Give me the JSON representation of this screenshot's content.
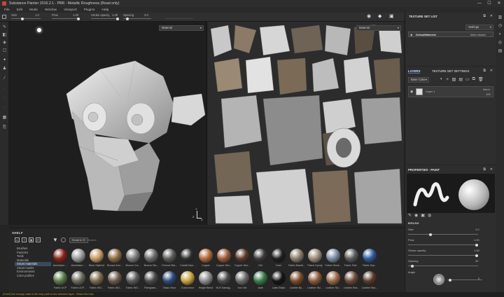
{
  "window": {
    "title": "Substance Painter 2016.2.1 - PBR - Metallic Roughness (Read only)",
    "controls": [
      "—",
      "☐",
      "✕"
    ]
  },
  "menu": [
    "File",
    "Edit",
    "Mode",
    "Window",
    "Viewport",
    "Plugins",
    "Help"
  ],
  "toolbar": {
    "size_label": "Size",
    "size_value": "1.0",
    "flow_label": "Flow",
    "flow_value": "1.00",
    "stroke_opacity_label": "Stroke opacity",
    "stroke_opacity_value": "1.00",
    "spacing_label": "Spacing",
    "spacing_value": "3.0"
  },
  "viewport3d": {
    "channel_dropdown": "Material",
    "axis_labels": {
      "x": "X",
      "y": "Y",
      "z": "Z"
    }
  },
  "viewport2d": {
    "channel_dropdown": "Material"
  },
  "shelf": {
    "title": "SHELF",
    "filter_tag": "Smart m",
    "search_placeholder": "Search...",
    "categories": [
      "Brushes",
      "Particles",
      "Tools",
      "Materials",
      "Smart materials",
      "Smart masks",
      "Environments",
      "Color profiles"
    ],
    "selected_category": "Smart materials",
    "materials_row1": [
      "Aluminium ...",
      "Aluminium ...",
      "Bone Stylized",
      "Bronze Arm...",
      "Bronze Cor...",
      "Bronze Sta...",
      "Chrome Bla...",
      "Cobalt Dam...",
      "Copper",
      "Copper Wor...",
      "Copper Wor...",
      "Dirt",
      "Dust",
      "Fabric Baseb...",
      "Fabric Sporty",
      "Fabric Stock...",
      "Fabric Soft...",
      "Fabric Sup..."
    ],
    "materials_row2": [
      "Fabric UCP",
      "Fabric UCP...",
      "Fabric WO...",
      "Fabric WO...",
      "Fabric WO...",
      "Fiberglass ...",
      "Glass Visor",
      "Gold Armor",
      "Height Blend",
      "HLR Damag...",
      "Iron Old",
      "Jade",
      "Latex Black",
      "Leather Bu...",
      "Leather Ski...",
      "Leather Ski...",
      "Leather Sea...",
      "Leather Sea..."
    ],
    "row1_colors": [
      "#8a2318",
      "#9a9a9a",
      "#c49a66",
      "#8a6a44",
      "#7a7a7a",
      "#6a6a6a",
      "#5a5a5a",
      "#2e2e2e",
      "#b06a3a",
      "#9a5a3a",
      "#5a3a2a",
      "#3a3a3a",
      "#1e1e1e",
      "#8a7a6a",
      "#9a8a7a",
      "#7a8aa0",
      "#5a5a5a",
      "#2e5a9a"
    ],
    "row2_colors": [
      "#5a7a4a",
      "#6a6a5a",
      "#7a6a4a",
      "#6a5a4a",
      "#5a5a5a",
      "#4a4a4a",
      "#2a4a7a",
      "#c8a040",
      "#8a8a8a",
      "#4a4a4a",
      "#6a6a6a",
      "#3a7a4a",
      "#141414",
      "#7a4a2a",
      "#8a5a3a",
      "#9a6a4a",
      "#6a4a3a",
      "#5a3a2a"
    ]
  },
  "texture_set_list": {
    "title": "TEXTURE SET LIST",
    "settings_dropdown": "Settings",
    "item": "DefaultMaterial",
    "shader": "Main shader"
  },
  "layers": {
    "tab1": "LAYERS",
    "tab2": "TEXTURE SET SETTINGS",
    "channel_dropdown": "Base Color",
    "layer_name": "Layer 1",
    "blend": "Norm",
    "opacity": "100"
  },
  "properties": {
    "title": "PROPERTIES - PAINT",
    "section": "BRUSH",
    "size_label": "Size",
    "size_value": "1.0",
    "flow_label": "Flow",
    "flow_value": "1.00",
    "stroke_opacity_label": "Stroke opacity",
    "stroke_opacity_value": "1.00",
    "spacing_label": "Spacing",
    "spacing_value": "30",
    "angle_label": "Angle",
    "angle_value": "0"
  },
  "status": "[Shelf] Not enough data in the help path to the selected layer - Read this help",
  "colors": {
    "accent": "#3a7bd5",
    "status": "#c9a21f"
  }
}
